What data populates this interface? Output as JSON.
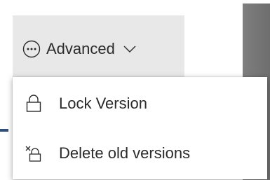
{
  "advanced": {
    "label": "Advanced",
    "icon": "more-circle-icon",
    "chevron_icon": "chevron-down-icon"
  },
  "menu": {
    "items": [
      {
        "label": "Lock Version",
        "icon": "lock-icon"
      },
      {
        "label": "Delete old versions",
        "icon": "delete-versions-icon"
      }
    ]
  },
  "colors": {
    "button_bg": "#e8e8e8",
    "text": "#2b2b2b",
    "menu_bg": "#ffffff",
    "accent": "#2f4f7a"
  }
}
